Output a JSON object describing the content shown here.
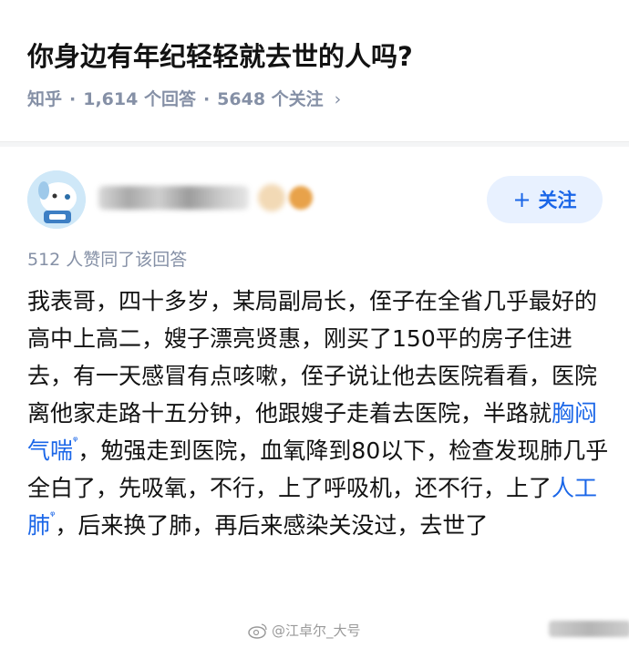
{
  "question": {
    "title": "你身边有年纪轻轻就去世的人吗?",
    "source": "知乎",
    "answers_count": "1,614 个回答",
    "followers_count": "5648 个关注",
    "chevron": "›"
  },
  "answer": {
    "author_avatar_icon": "cartoon-dog-avatar-icon",
    "follow_button_label": "关注",
    "follow_button_icon": "plus-icon",
    "likes_text": "512 人赞同了该回答",
    "content": [
      "我表哥，四十多岁，某局副局长，侄子在全省几乎最好的高中上高二，嫂子漂亮贤惠，刚买了150平的房子住进去，有一天感冒有点咳嗽，侄子说让他去医院看看，医院离他家走路十五分钟，他跟嫂子走着去医院，半路就",
      "，勉强走到医院，血氧降到80以下，检查发现肺几乎全白了，先吸氧，不行，上了呼吸机，还不行，上了",
      "，后来换了肺，再后来感染关没过，去世了"
    ],
    "keywords": [
      "胸闷气喘",
      "人工肺"
    ],
    "keyword_search_icon": "search-icon"
  },
  "watermark": {
    "text": "@江卓尔_大号",
    "icon": "weibo-icon"
  },
  "colors": {
    "accent": "#1a66e8",
    "meta_gray": "#8590a6",
    "follow_bg": "#e8f1ff"
  }
}
